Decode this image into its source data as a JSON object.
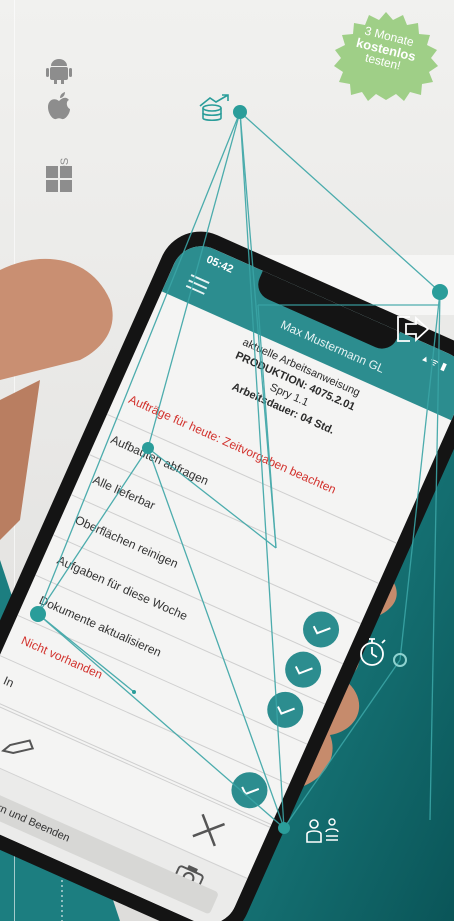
{
  "badge": {
    "line1": "3 Monate",
    "line2": "kostenlos",
    "line3": "testen!",
    "color": "#9fcf87"
  },
  "platforms": {
    "ios_label": "iOS",
    "icons": [
      "android-icon",
      "apple-icon",
      "windows-icon"
    ]
  },
  "phone": {
    "time": "05:42",
    "status_icons": "▴ ᯤ ▮",
    "title": "Max Mustermann GL",
    "info_lines": [
      "aktuelle Arbeitsanweisung",
      "PRODUKTION: 4075.2.01",
      "Spry 1.1",
      "Arbeitsdauer: 04 Std."
    ],
    "tasks": [
      {
        "label": "Aufträge für heute: Zeitvorgaben beachten",
        "red": true,
        "check": false
      },
      {
        "label": "Aufbauten abfragen",
        "red": false,
        "check": false
      },
      {
        "label": "Alle lieferbar",
        "red": false,
        "check": false
      },
      {
        "label": "Oberflächen reinigen",
        "red": false,
        "check": true
      },
      {
        "label": "Aufgaben für diese Woche",
        "red": false,
        "check": true
      },
      {
        "label": "Dokumente aktualisieren",
        "red": false,
        "check": true
      },
      {
        "label": "Nicht vorhanden",
        "red": true,
        "check": false
      },
      {
        "label": "In",
        "red": false,
        "check": true
      }
    ],
    "save_label": "Speichern und Beenden"
  },
  "feature_icons": [
    "money-icon",
    "logout-icon",
    "stopwatch-icon",
    "team-icon"
  ],
  "colors": {
    "teal": "#2c8d8f",
    "dark_teal": "#0f5f63",
    "accent": "#2a9d9a"
  }
}
